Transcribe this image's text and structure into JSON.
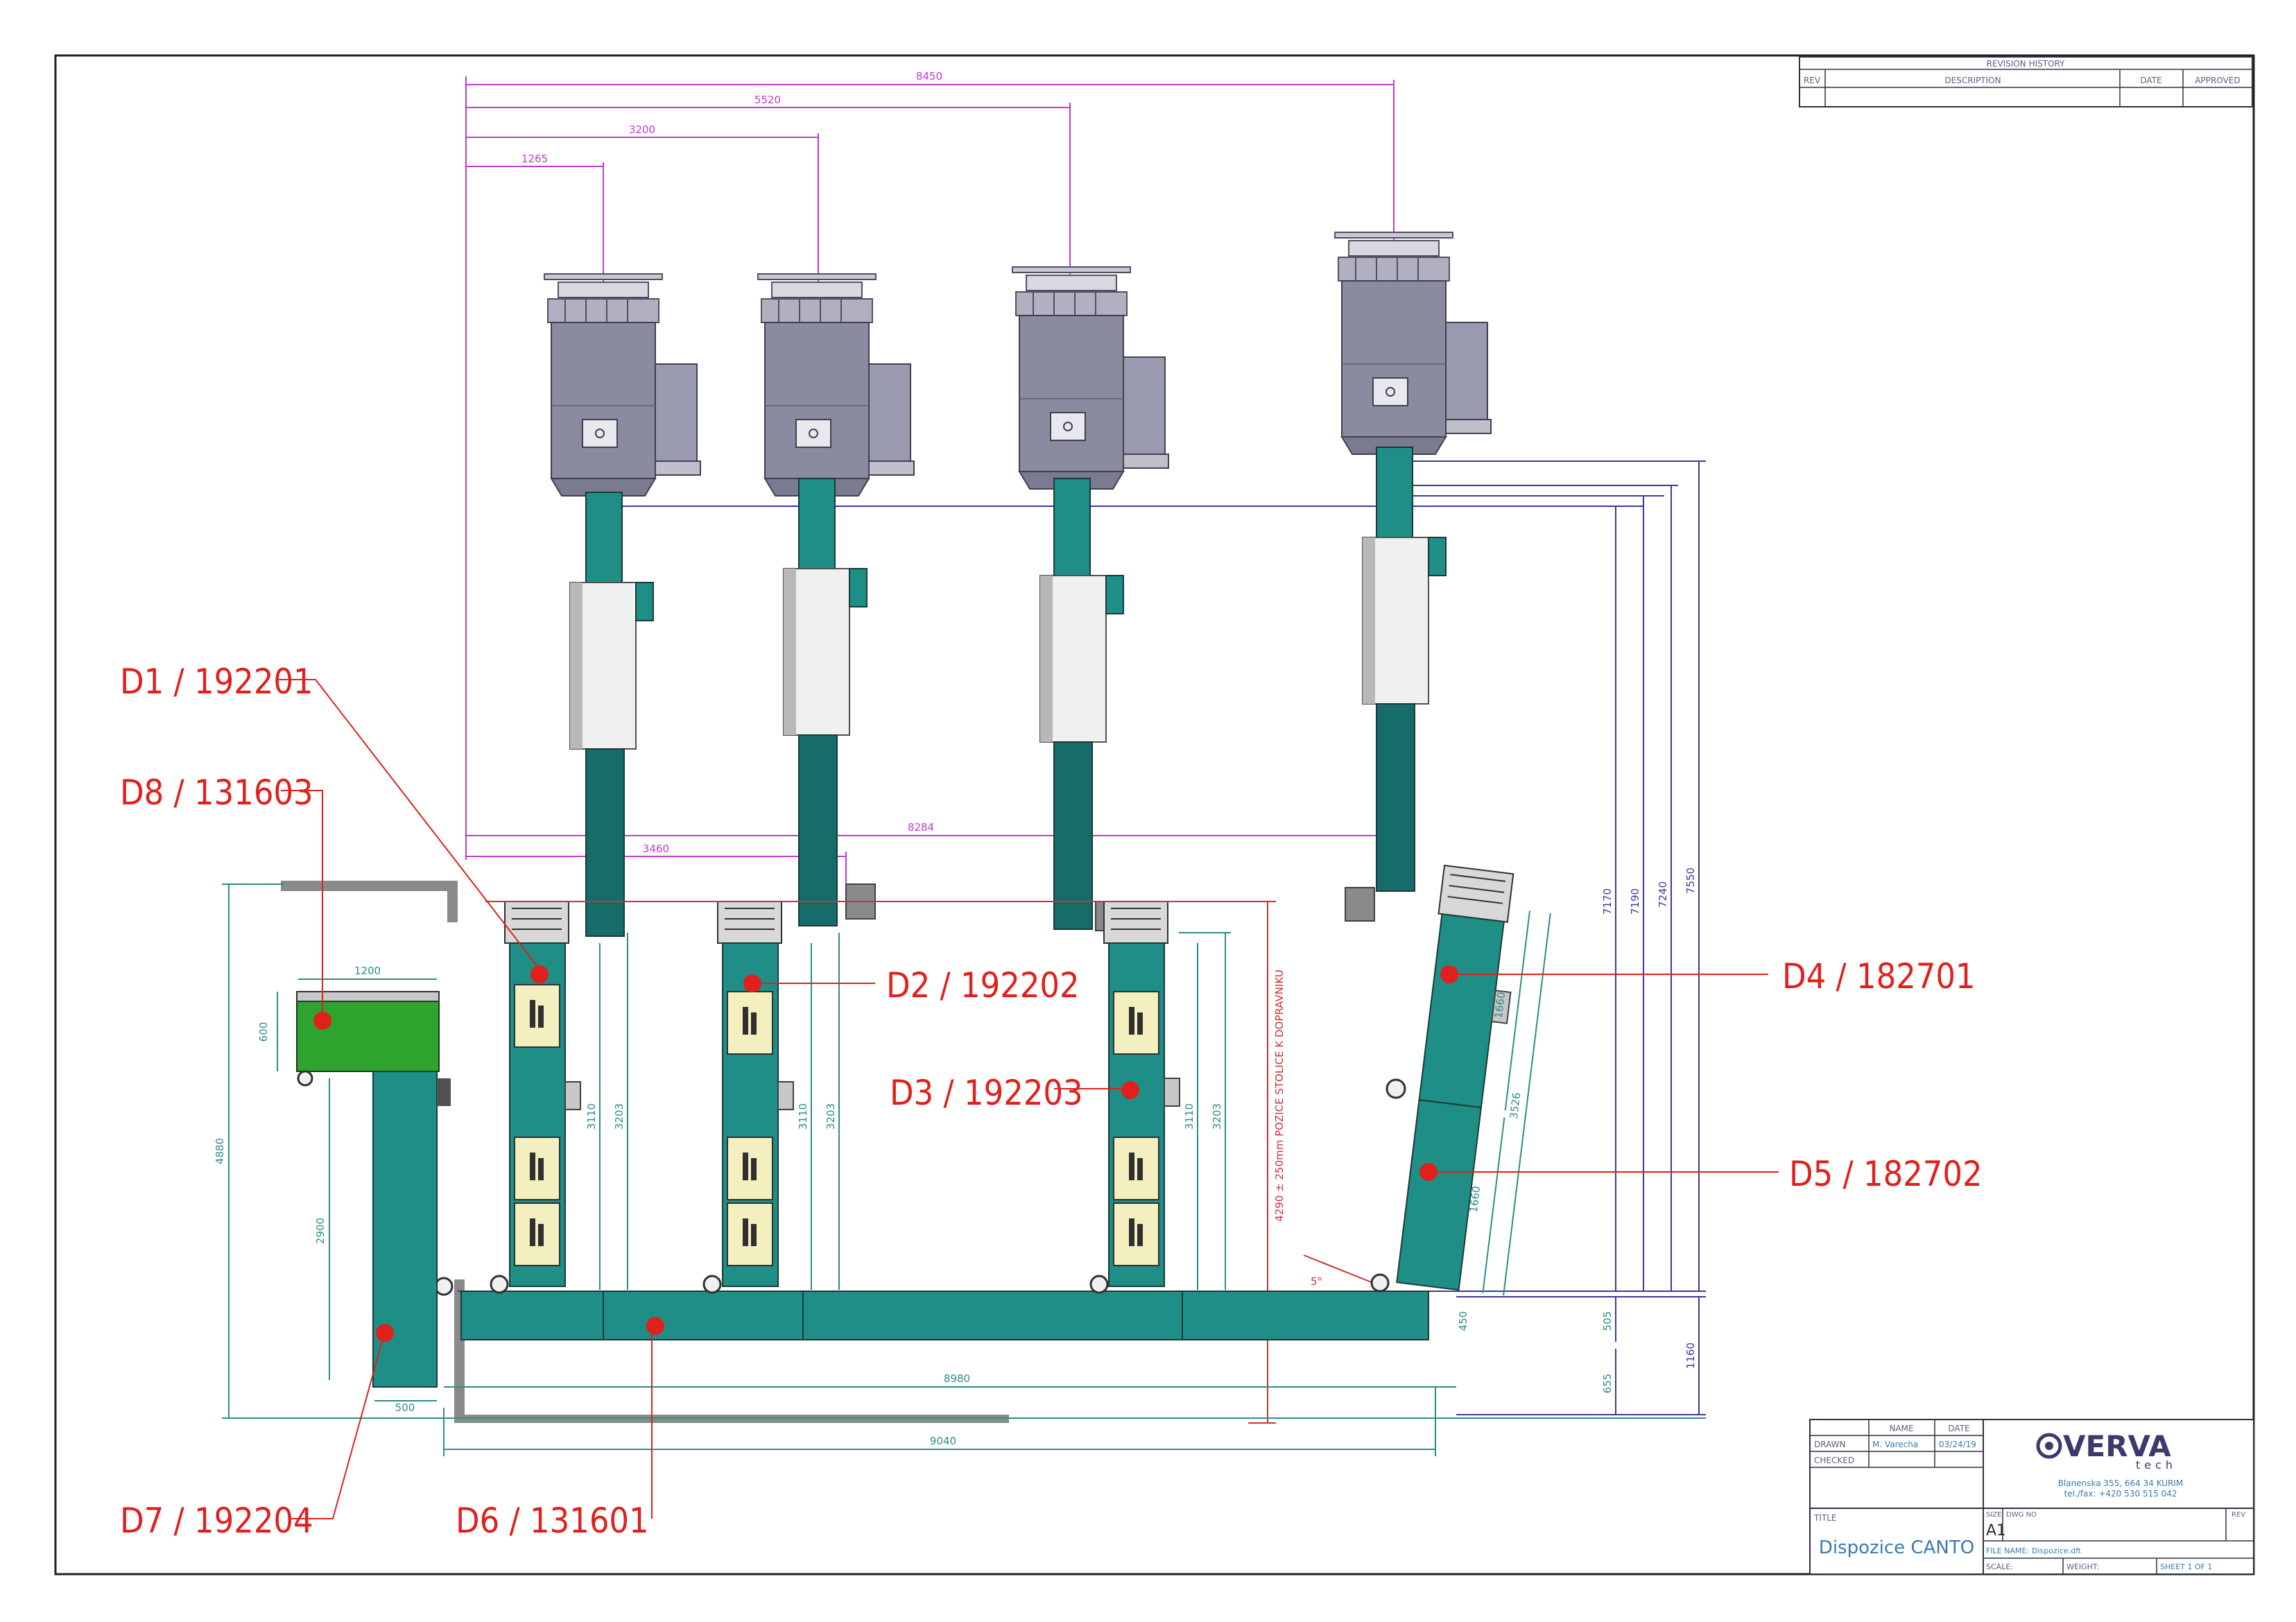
{
  "colors": {
    "frame": "#202020",
    "teal": "#1f8e86",
    "teal_dark": "#166c68",
    "magenta": "#c03cd0",
    "dim_teal": "#2c8c88",
    "dim_blue": "#3a3a9c",
    "callout_red": "#e0201c",
    "green": "#2ea32e",
    "machine_grey": "#8a8aa0",
    "cream": "#f3efbe"
  },
  "callouts": {
    "d1": "D1 / 192201",
    "d2": "D2 / 192202",
    "d3": "D3 / 192203",
    "d4": "D4 / 182701",
    "d5": "D5 / 182702",
    "d6": "D6 / 131601",
    "d7": "D7 / 192204",
    "d8": "D8 / 131603"
  },
  "dimensions": {
    "top_8450": "8450",
    "top_5520": "5520",
    "top_3200": "3200",
    "top_1265": "1265",
    "mid_8284": "8284",
    "mid_3460": "3460",
    "green_1200": "1200",
    "green_600": "600",
    "left_4880": "4880",
    "d7_2900": "2900",
    "d7_500": "500",
    "d1_3110": "3110",
    "d1_3203": "3203",
    "d2_3110": "3110",
    "d2_3203": "3203",
    "d3_3110": "3110",
    "d3_3203": "3203",
    "red_note": "4290 ± 250mm POZICE STOLICE K DOPRAVNIKU",
    "angle": "5°",
    "d4_1660": "1660",
    "d45_3526": "3526",
    "d5_1660": "1660",
    "d6_450": "450",
    "right_7170": "7170",
    "right_7190": "7190",
    "right_7240": "7240",
    "right_7550": "7550",
    "right_505": "505",
    "right_655": "655",
    "right_1160": "1160",
    "bottom_8980": "8980",
    "bottom_9040": "9040"
  },
  "revision": {
    "title": "REVISION HISTORY",
    "col_rev": "REV",
    "col_description": "DESCRIPTION",
    "col_date": "DATE",
    "col_approved": "APPROVED"
  },
  "title_block": {
    "col_name": "NAME",
    "col_date": "DATE",
    "drawn_label": "DRAWN",
    "drawn_name": "M. Varecha",
    "drawn_date": "03/24/19",
    "checked_label": "CHECKED",
    "company_name": "VERVA",
    "company_sub": "tech",
    "address_line1": "Blanenska 355, 664 34 KURIM",
    "address_line2": "tel./fax: +420 530 515 042",
    "title_label": "TITLE",
    "title_value": "Dispozice CANTO",
    "size_label": "SIZE",
    "size_value": "A1",
    "dwg_no_label": "DWG NO",
    "rev_label": "REV",
    "file_name_label": "FILE NAME:",
    "file_name_value": "Dispozice.dft",
    "scale_label": "SCALE:",
    "weight_label": "WEIGHT:",
    "sheet": "SHEET 1 OF 1"
  }
}
